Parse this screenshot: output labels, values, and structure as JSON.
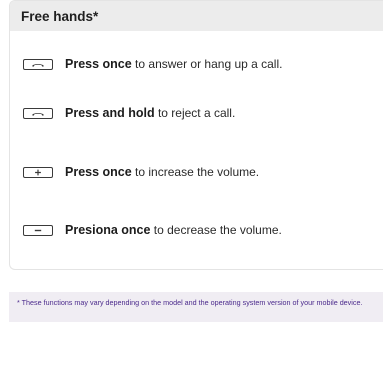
{
  "card": {
    "title": "Free hands*",
    "items": [
      {
        "icon": "phone-handset-icon",
        "bold": "Press once",
        "text": " to answer or hang up a call."
      },
      {
        "icon": "phone-handset-icon",
        "bold": "Press and hold",
        "text": " to reject a call."
      },
      {
        "icon": "plus-key-icon",
        "bold": "Press once",
        "text": " to increase the volume."
      },
      {
        "icon": "minus-key-icon",
        "bold": "Presiona once",
        "text": " to decrease the volume."
      }
    ]
  },
  "note": {
    "text": "* These functions may vary depending on the model and the operating system version of your mobile device."
  },
  "colors": {
    "header_bg": "#ececec",
    "note_bg": "#f0edf3",
    "note_text": "#4b2a8c"
  }
}
